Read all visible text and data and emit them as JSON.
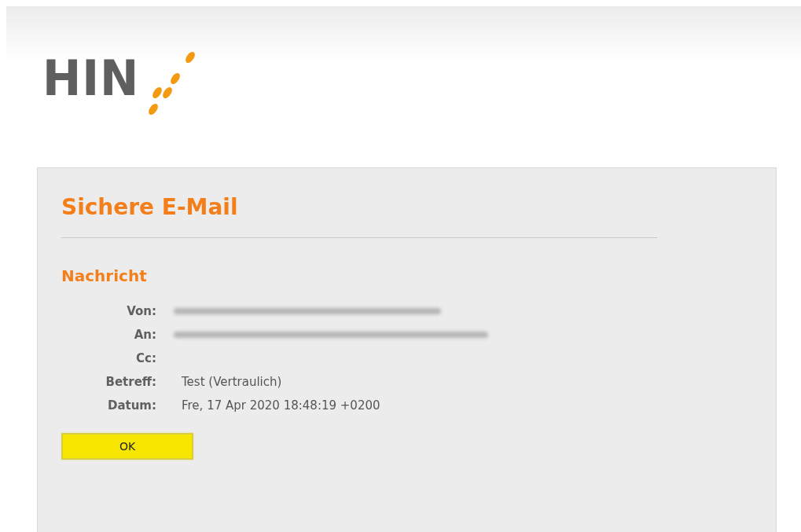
{
  "logo": {
    "text": "HIN"
  },
  "panel": {
    "title": "Sichere E-Mail",
    "section": "Nachricht",
    "fields": [
      {
        "label": "Von:",
        "kind": "redacted"
      },
      {
        "label": "An:",
        "kind": "redacted"
      },
      {
        "label": "Cc:",
        "kind": "empty"
      },
      {
        "label": "Betreff:",
        "kind": "text",
        "value": "Test (Vertraulich)"
      },
      {
        "label": "Datum:",
        "kind": "text",
        "value": "Fre, 17 Apr 2020 18:48:19 +0200"
      }
    ],
    "button": {
      "label": "OK"
    }
  }
}
